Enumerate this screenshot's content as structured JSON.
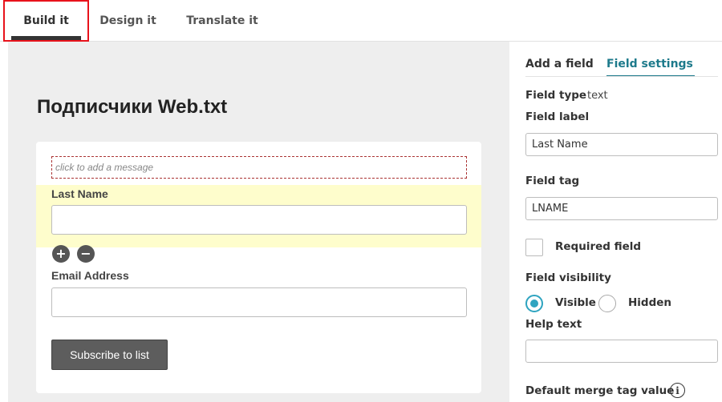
{
  "tabs": {
    "build": "Build it",
    "design": "Design it",
    "translate": "Translate it"
  },
  "form": {
    "title": "Подписчики Web.txt",
    "message_placeholder": "click to add a message",
    "fields": [
      {
        "label": "Last Name",
        "value": ""
      },
      {
        "label": "Email Address",
        "value": ""
      }
    ],
    "add_symbol": "+",
    "remove_symbol": "−",
    "subscribe_label": "Subscribe to list"
  },
  "panel": {
    "tab_add": "Add a field",
    "tab_settings": "Field settings",
    "field_type_label": "Field type",
    "field_type_value": "text",
    "field_label_label": "Field label",
    "field_label_value": "Last Name",
    "field_tag_label": "Field tag",
    "field_tag_value": "LNAME",
    "required_label": "Required field",
    "required_checked": false,
    "visibility_label": "Field visibility",
    "visible_label": "Visible",
    "hidden_label": "Hidden",
    "visibility_selected": "Visible",
    "help_text_label": "Help text",
    "help_text_value": "",
    "default_merge_label": "Default merge tag value",
    "info_glyph": "i"
  },
  "colors": {
    "accent": "#1d7a8b",
    "radio_selected": "#2fa4c0",
    "active_tab_outline": "#e8121b",
    "field_highlight": "#fefdcc"
  },
  "icons": [
    "plus-circle-icon",
    "minus-circle-icon",
    "info-icon"
  ]
}
